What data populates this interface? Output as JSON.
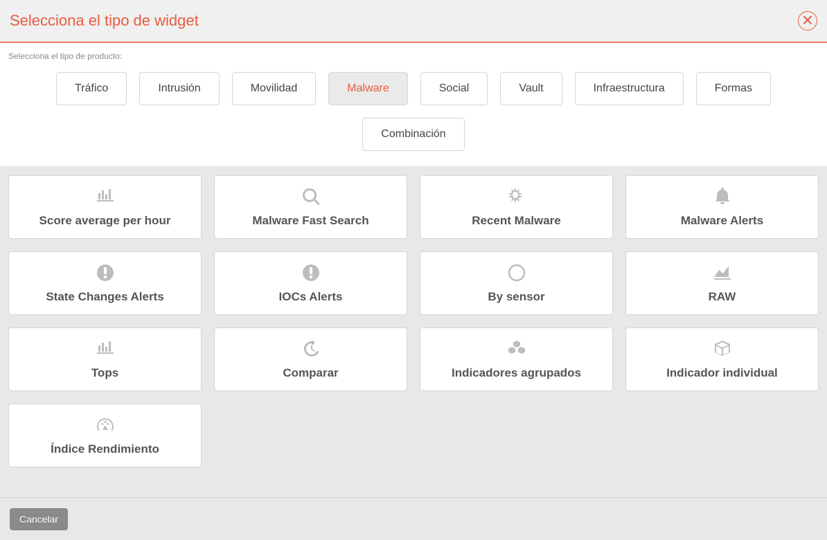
{
  "header": {
    "title": "Selecciona el tipo de widget"
  },
  "product_section": {
    "label": "Selecciona el tipo de producto:",
    "items": [
      {
        "label": "Tráfico",
        "active": false
      },
      {
        "label": "Intrusión",
        "active": false
      },
      {
        "label": "Movilidad",
        "active": false
      },
      {
        "label": "Malware",
        "active": true
      },
      {
        "label": "Social",
        "active": false
      },
      {
        "label": "Vault",
        "active": false
      },
      {
        "label": "Infraestructura",
        "active": false
      },
      {
        "label": "Formas",
        "active": false
      },
      {
        "label": "Combinación",
        "active": false
      }
    ]
  },
  "widgets": [
    {
      "label": "Score average per hour",
      "icon": "bar-chart-icon"
    },
    {
      "label": "Malware Fast Search",
      "icon": "search-icon"
    },
    {
      "label": "Recent Malware",
      "icon": "bug-icon"
    },
    {
      "label": "Malware Alerts",
      "icon": "bell-icon"
    },
    {
      "label": "State Changes Alerts",
      "icon": "exclamation-circle-icon"
    },
    {
      "label": "IOCs Alerts",
      "icon": "exclamation-circle-icon"
    },
    {
      "label": "By sensor",
      "icon": "circle-outline-icon"
    },
    {
      "label": "RAW",
      "icon": "area-chart-icon"
    },
    {
      "label": "Tops",
      "icon": "bar-chart-icon"
    },
    {
      "label": "Comparar",
      "icon": "history-icon"
    },
    {
      "label": "Indicadores agrupados",
      "icon": "cubes-icon"
    },
    {
      "label": "Indicador individual",
      "icon": "cube-icon"
    },
    {
      "label": "Índice Rendimiento",
      "icon": "gauge-icon"
    }
  ],
  "footer": {
    "cancel_label": "Cancelar"
  }
}
